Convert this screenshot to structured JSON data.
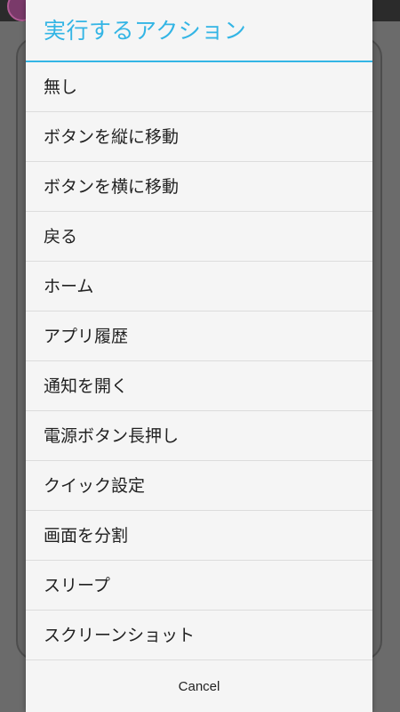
{
  "dialog": {
    "title": "実行するアクション",
    "items": [
      {
        "label": "無し"
      },
      {
        "label": "ボタンを縦に移動"
      },
      {
        "label": "ボタンを横に移動"
      },
      {
        "label": "戻る"
      },
      {
        "label": "ホーム"
      },
      {
        "label": "アプリ履歴"
      },
      {
        "label": "通知を開く"
      },
      {
        "label": "電源ボタン長押し"
      },
      {
        "label": "クイック設定"
      },
      {
        "label": "画面を分割"
      },
      {
        "label": "スリープ"
      },
      {
        "label": "スクリーンショット"
      }
    ],
    "cancel_label": "Cancel"
  },
  "colors": {
    "accent": "#33b5e5",
    "dialog_bg": "#f5f5f5",
    "scrim": "#6b6b6b"
  }
}
